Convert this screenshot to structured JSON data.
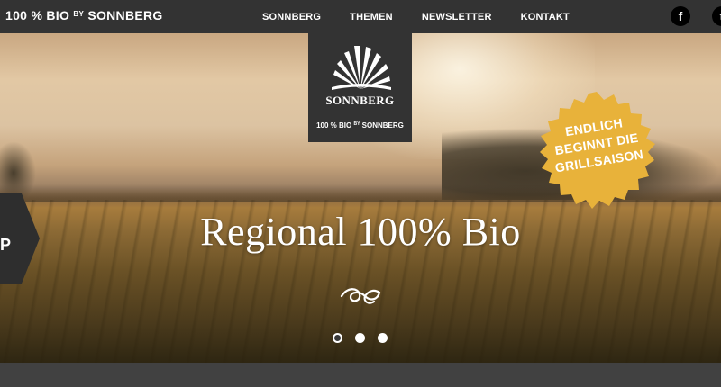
{
  "header": {
    "brand_main": "100 % BIO",
    "brand_by": "BY",
    "brand_end": "SONNBERG",
    "nav": [
      {
        "label": "SONNBERG"
      },
      {
        "label": "THEMEN"
      },
      {
        "label": "NEWSLETTER"
      },
      {
        "label": "KONTAKT"
      }
    ],
    "social": {
      "facebook": "f",
      "second": "t"
    }
  },
  "logo": {
    "name": "SONNBERG",
    "sub_main": "100 % BIO",
    "sub_by": "BY",
    "sub_end": "SONNBERG"
  },
  "badge": {
    "lines": [
      "ENDLICH",
      "BEGINNT DIE",
      "GRILLSAISON"
    ],
    "color": "#e8b23a"
  },
  "side_tab": {
    "label": "P"
  },
  "hero": {
    "headline": "Regional 100% Bio",
    "slides_total": 3,
    "active_slide": 1
  },
  "colors": {
    "bar": "#333333",
    "accent": "#e8b23a"
  }
}
